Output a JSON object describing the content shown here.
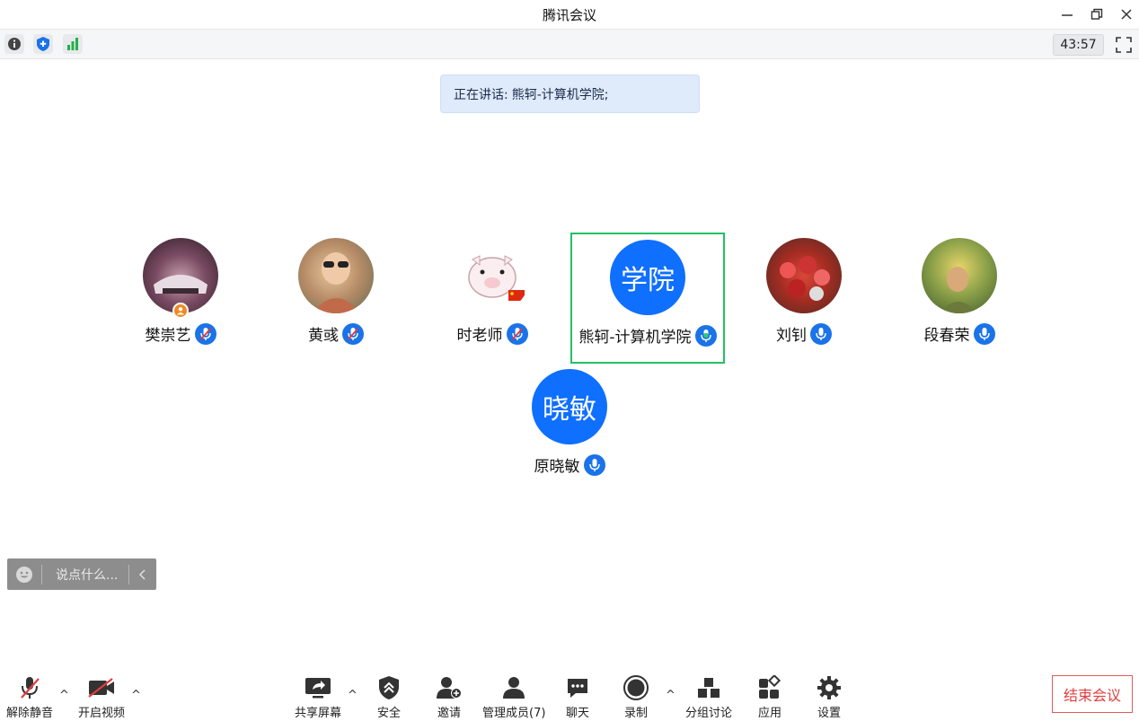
{
  "window": {
    "title": "腾讯会议"
  },
  "toolbar": {
    "timer": "43:57"
  },
  "speaker_banner": {
    "prefix": "正在讲话:",
    "name": "熊轲-计算机学院;"
  },
  "participants": [
    {
      "name": "樊崇艺",
      "avatar_text": "",
      "mic": "muted",
      "host": true
    },
    {
      "name": "黄彧",
      "avatar_text": "",
      "mic": "muted"
    },
    {
      "name": "时老师",
      "avatar_text": "",
      "mic": "muted"
    },
    {
      "name": "熊轲-计算机学院",
      "avatar_text": "学院",
      "mic": "speaking",
      "active": true
    },
    {
      "name": "刘钊",
      "avatar_text": "",
      "mic": "on"
    },
    {
      "name": "段春荣",
      "avatar_text": "",
      "mic": "on"
    },
    {
      "name": "原晓敏",
      "avatar_text": "晓敏",
      "mic": "on"
    }
  ],
  "chat": {
    "placeholder": "说点什么..."
  },
  "bottom": {
    "unmute": "解除静音",
    "start_video": "开启视频",
    "share_screen": "共享屏幕",
    "security": "安全",
    "invite": "邀请",
    "manage_members": "管理成员(7)",
    "chat": "聊天",
    "record": "录制",
    "breakout": "分组讨论",
    "apps": "应用",
    "settings": "设置",
    "end_meeting": "结束会议"
  },
  "colors": {
    "accent": "#0f6fff",
    "active_border": "#22c064",
    "end_red": "#e23d3d"
  }
}
